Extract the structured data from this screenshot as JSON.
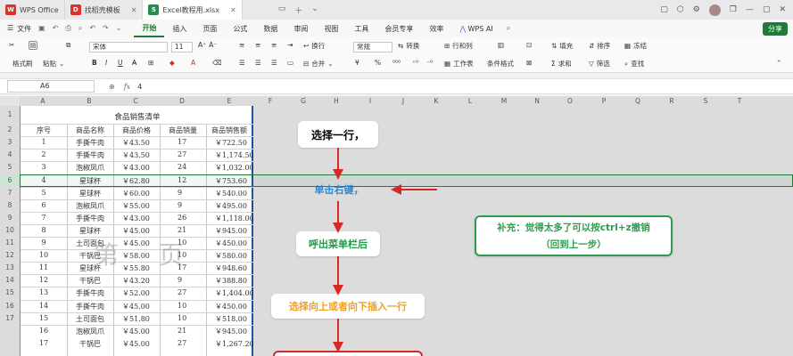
{
  "titlebar": {
    "tabs": [
      {
        "label": "WPS Office",
        "color": "#d9332a"
      },
      {
        "label": "找稻壳模板",
        "color": "#d9332a"
      },
      {
        "label": "Excel教程用.xlsx",
        "color": "#1f8f4a"
      }
    ],
    "window_controls": [
      "minimize-icon",
      "maximize-icon",
      "close-icon"
    ]
  },
  "menubar": {
    "file_label": "文件",
    "items": [
      "开始",
      "插入",
      "页面",
      "公式",
      "数据",
      "审阅",
      "视图",
      "工具",
      "会员专享",
      "效率",
      "WPS AI"
    ],
    "active_item": "开始",
    "share_label": "分享"
  },
  "ribbon": {
    "format_painter": "格式刷",
    "paste": "粘贴",
    "font_name": "宋体",
    "font_size": "11",
    "wrap": "换行",
    "merge": "合并",
    "number_format": "常规",
    "convert": "转换",
    "row_col": "行和列",
    "worksheet": "工作表",
    "cond_format": "条件格式",
    "fill": "填充",
    "sort": "排序",
    "freeze": "冻结",
    "sum": "求和",
    "filter": "筛选",
    "find": "查找"
  },
  "formula_bar": {
    "cell_ref": "A6",
    "value": "4"
  },
  "columns": [
    "A",
    "B",
    "C",
    "D",
    "E",
    "F",
    "G",
    "H",
    "I",
    "J",
    "K",
    "L",
    "M",
    "N",
    "O",
    "P",
    "Q",
    "R",
    "S",
    "T"
  ],
  "rows": [
    "1",
    "2",
    "3",
    "4",
    "5",
    "6",
    "7",
    "8",
    "9",
    "10",
    "11",
    "12",
    "13",
    "14",
    "15",
    "16",
    "17"
  ],
  "table": {
    "title": "食品销售清单",
    "headers": [
      "序号",
      "商品名称",
      "商品价格",
      "商品销量",
      "商品销售额"
    ],
    "data": [
      [
        "1",
        "手撕牛肉",
        "￥43.50",
        "17",
        "￥722.50"
      ],
      [
        "2",
        "手撕牛肉",
        "￥43.50",
        "27",
        "￥1,174.50"
      ],
      [
        "3",
        "泡椒凤爪",
        "￥43.00",
        "24",
        "￥1,032.00"
      ],
      [
        "4",
        "星球杯",
        "￥62.80",
        "12",
        "￥753.60"
      ],
      [
        "5",
        "星球杯",
        "￥60.00",
        "9",
        "￥540.00"
      ],
      [
        "6",
        "泡椒凤爪",
        "￥55.00",
        "9",
        "￥495.00"
      ],
      [
        "7",
        "手撕牛肉",
        "￥43.00",
        "26",
        "￥1,118.00"
      ],
      [
        "8",
        "星球杯",
        "￥45.00",
        "21",
        "￥945.00"
      ],
      [
        "9",
        "土司面包",
        "￥45.00",
        "10",
        "￥450.00"
      ],
      [
        "10",
        "干锅巴",
        "￥58.00",
        "10",
        "￥580.00"
      ],
      [
        "11",
        "星球杯",
        "￥55.80",
        "17",
        "￥948.60"
      ],
      [
        "12",
        "干锅巴",
        "￥43.20",
        "9",
        "￥388.80"
      ],
      [
        "13",
        "手撕牛肉",
        "￥52.00",
        "27",
        "￥1,404.00"
      ],
      [
        "14",
        "手撕牛肉",
        "￥45.00",
        "10",
        "￥450.00"
      ],
      [
        "15",
        "土司面包",
        "￥51.80",
        "10",
        "￥518.00"
      ],
      [
        "16",
        "泡椒凤爪",
        "￥45.00",
        "21",
        "￥945.00"
      ],
      [
        "17",
        "干锅巴",
        "￥45.00",
        "27",
        "￥1,267.20"
      ]
    ]
  },
  "watermark": "第 页",
  "flow": {
    "step1": "选择一行，",
    "step2": "单击右键，",
    "step3": "呼出菜单栏后",
    "step4": "选择向上或者向下插入一行",
    "note_line1": "补充：觉得太多了可以按ctrl+z撤销",
    "note_line2": "（回到上一步）",
    "colors": {
      "step1": "#000000",
      "step2": "#2a8ad6",
      "step3": "#1f9a45",
      "step4": "#f0a020",
      "arrow": "#d62828",
      "note_border": "#2e9c4f",
      "note_text": "#2e9c4f",
      "selection": "#1f7a3a"
    }
  }
}
